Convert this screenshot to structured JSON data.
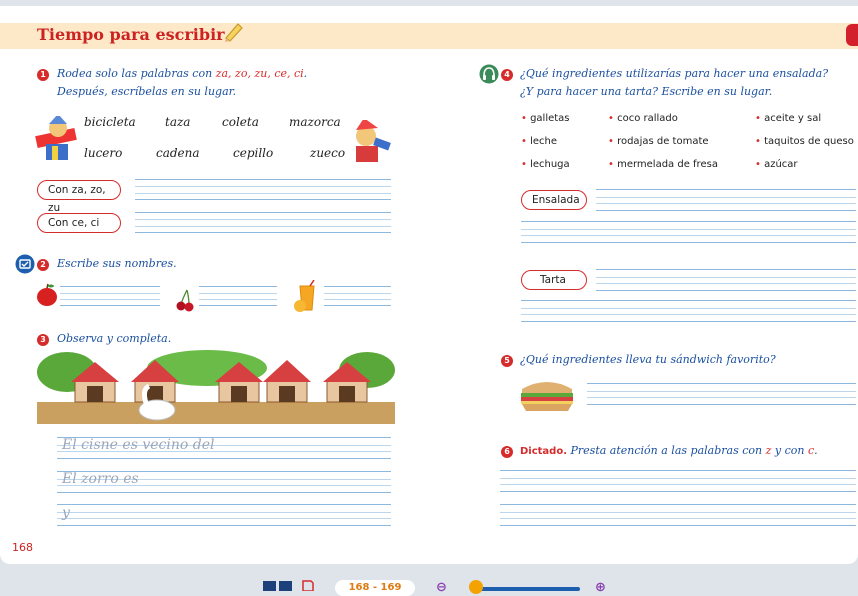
{
  "header": {
    "title": "Tiempo para escribir"
  },
  "left": {
    "ex1": {
      "num": "1",
      "line1_prefix": "Rodea solo las palabras con ",
      "line1_hl": "za, zo, zu, ce, ci",
      "line1_suffix": ".",
      "line2": "Después, escríbelas en su lugar."
    },
    "words_row1": [
      "bicicleta",
      "taza",
      "coleta",
      "mazorca"
    ],
    "words_row2": [
      "lucero",
      "cadena",
      "cepillo",
      "zueco"
    ],
    "label_za": "Con za, zo, zu",
    "label_ce": "Con ce, ci",
    "ex2": {
      "num": "2",
      "text": "Escribe sus nombres."
    },
    "ex3": {
      "num": "3",
      "text": "Observa y completa."
    },
    "sentences": [
      "El cisne es vecino del",
      "El zorro es",
      "y"
    ],
    "page_number": "168"
  },
  "right": {
    "ex4": {
      "num": "4",
      "line1": "¿Qué ingredientes utilizarías para hacer una ensalada?",
      "line2": "¿Y para hacer una tarta? Escribe en su lugar."
    },
    "ingredients": [
      [
        "galletas",
        "coco rallado",
        "aceite y sal"
      ],
      [
        "leche",
        "rodajas de tomate",
        "taquitos de queso"
      ],
      [
        "lechuga",
        "mermelada de fresa",
        "azúcar"
      ]
    ],
    "label_ensalada": "Ensalada",
    "label_tarta": "Tarta",
    "ex5": {
      "num": "5",
      "text": "¿Qué ingredientes lleva tu sándwich favorito?"
    },
    "ex6": {
      "num": "6",
      "bold": "Dictado.",
      "text_prefix": " Presta atención a las palabras con ",
      "hl1": "z",
      "mid": " y con ",
      "hl2": "c",
      "suffix": "."
    }
  },
  "toolbar": {
    "page_range": "168 - 169",
    "zoom_level": 0.05
  },
  "icons": [
    "pencil-icon",
    "headphones-icon",
    "digital-activity-icon",
    "apple-icon",
    "cherry-icon",
    "juice-icon",
    "page-layout-icon",
    "bookmark-icon",
    "zoom-out-icon",
    "zoom-in-icon"
  ],
  "colors": {
    "accent_red": "#d62b2b",
    "instruction_blue": "#1a4fa0",
    "header_bg": "#fde9c8",
    "page_badge": "#e07a10",
    "zoom_track": "#1d5fae"
  }
}
